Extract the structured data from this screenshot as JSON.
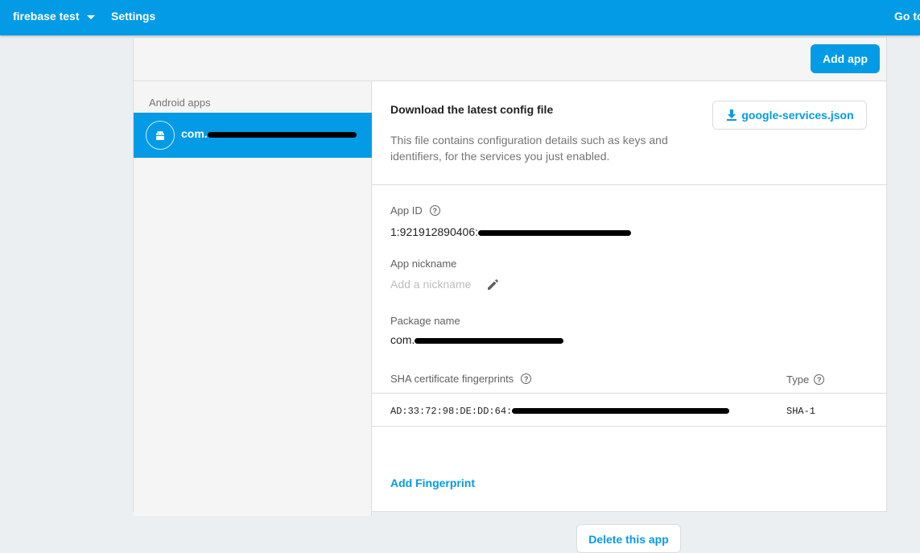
{
  "topbar": {
    "project_name": "firebase test",
    "breadcrumb": "Settings",
    "goto_label": "Go to"
  },
  "header": {
    "add_app_label": "Add app"
  },
  "sidebar": {
    "heading": "Android apps",
    "app_name_prefix": "com."
  },
  "download": {
    "title": "Download the latest config file",
    "description": "This file contains configuration details such as keys and identifiers, for the services you just enabled.",
    "button_label": "google-services.json"
  },
  "fields": {
    "app_id_label": "App ID",
    "app_id_prefix": "1:921912890406:",
    "nickname_label": "App nickname",
    "nickname_placeholder": "Add a nickname",
    "package_label": "Package name",
    "package_prefix": "com."
  },
  "fingerprints": {
    "header_label": "SHA certificate fingerprints",
    "type_header": "Type",
    "rows": [
      {
        "fingerprint_prefix": "AD:33:72:98:DE:DD:64:",
        "type": "SHA-1"
      }
    ],
    "add_label": "Add Fingerprint"
  },
  "delete_label": "Delete this app",
  "colors": {
    "primary": "#039be5",
    "background": "#eceff1",
    "panel": "#f5f5f5",
    "text": "#212121",
    "muted": "#757575"
  },
  "icons": {
    "project_dropdown": "caret-down-icon",
    "android": "android-icon",
    "download": "download-icon",
    "help": "help-circle-icon",
    "edit": "pencil-icon"
  }
}
